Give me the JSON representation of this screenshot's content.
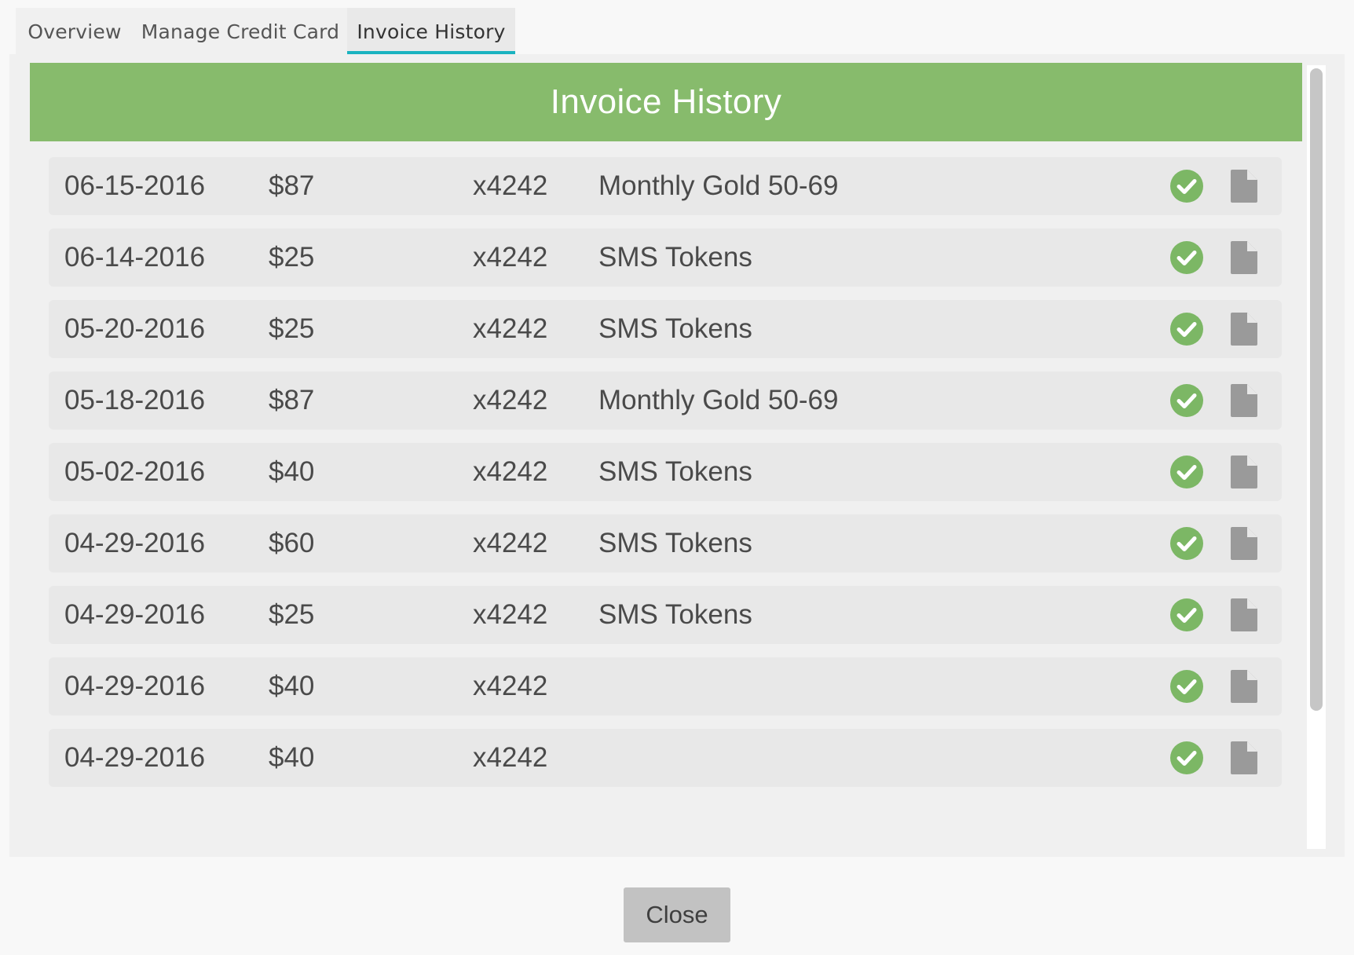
{
  "tabs": [
    {
      "label": "Overview"
    },
    {
      "label": "Manage Credit Card"
    },
    {
      "label": "Invoice History"
    }
  ],
  "banner": {
    "title": "Invoice History"
  },
  "colors": {
    "accent_green": "#87bb6c",
    "status_green": "#7cb765",
    "tab_indicator": "#1bb3c0"
  },
  "icons": {
    "paid": "check-circle-icon",
    "invoice": "document-icon"
  },
  "invoices": [
    {
      "date": "06-15-2016",
      "amount": "$87",
      "card": "x4242",
      "description": "Monthly Gold 50-69"
    },
    {
      "date": "06-14-2016",
      "amount": "$25",
      "card": "x4242",
      "description": "SMS Tokens"
    },
    {
      "date": "05-20-2016",
      "amount": "$25",
      "card": "x4242",
      "description": "SMS Tokens"
    },
    {
      "date": "05-18-2016",
      "amount": "$87",
      "card": "x4242",
      "description": "Monthly Gold 50-69"
    },
    {
      "date": "05-02-2016",
      "amount": "$40",
      "card": "x4242",
      "description": "SMS Tokens"
    },
    {
      "date": "04-29-2016",
      "amount": "$60",
      "card": "x4242",
      "description": "SMS Tokens"
    },
    {
      "date": "04-29-2016",
      "amount": "$25",
      "card": "x4242",
      "description": "SMS Tokens"
    },
    {
      "date": "04-29-2016",
      "amount": "$40",
      "card": "x4242",
      "description": ""
    },
    {
      "date": "04-29-2016",
      "amount": "$40",
      "card": "x4242",
      "description": ""
    }
  ],
  "footer": {
    "close_label": "Close"
  }
}
